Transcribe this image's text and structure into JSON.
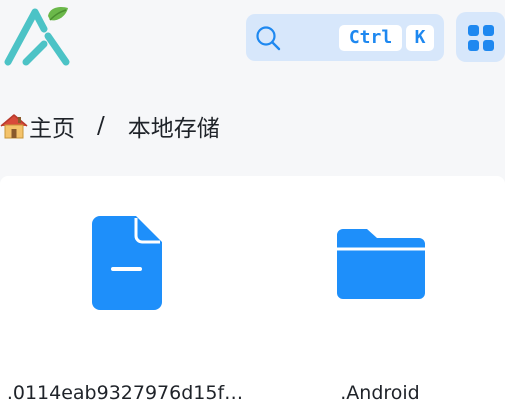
{
  "search": {
    "shortcut_ctrl": "Ctrl",
    "shortcut_key": "K"
  },
  "breadcrumb": {
    "home_label": "主页",
    "separator": "/",
    "current_label": "本地存储"
  },
  "files": [
    {
      "name": ".0114eab9327976d15f…",
      "icon": "document-icon"
    },
    {
      "name": ".Android",
      "icon": "folder-icon"
    }
  ],
  "colors": {
    "accent": "#1e8ffa",
    "search_bg": "#d7e7fb",
    "logo_teal": "#4cc3c6",
    "logo_leaf": "#6bb84a"
  }
}
